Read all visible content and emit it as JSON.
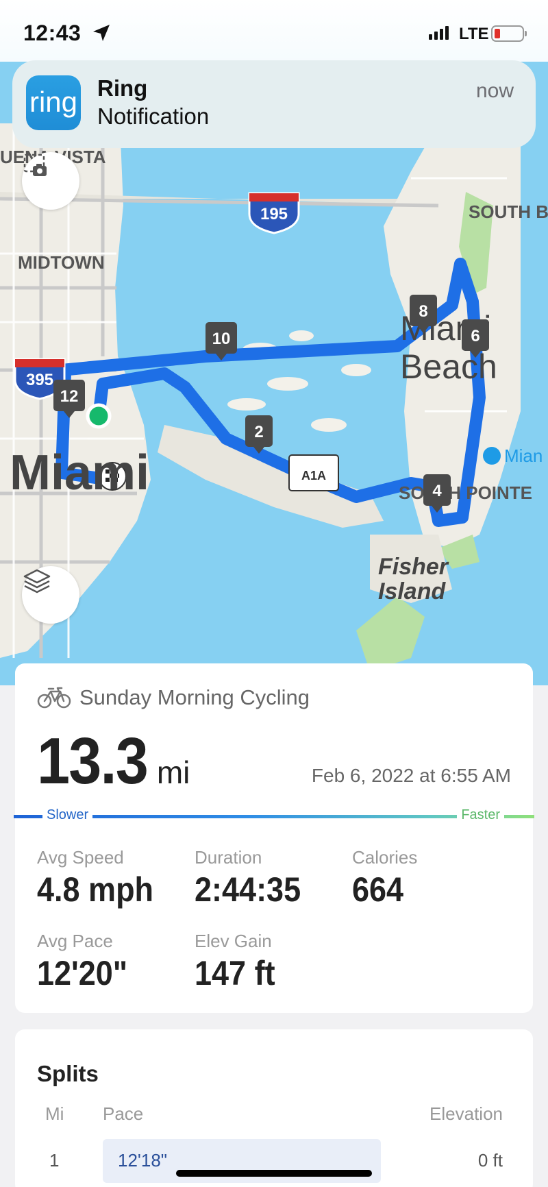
{
  "status_bar": {
    "time": "12:43",
    "network": "LTE"
  },
  "notification": {
    "app_icon_text": "ring",
    "title": "Ring",
    "body": "Notification",
    "time": "now"
  },
  "map": {
    "labels": {
      "buena_vista": "UENA VISTA",
      "south_beach": "SOUTH B",
      "midtown": "MIDTOWN",
      "miami": "Miami",
      "miami_beach_1": "Miami",
      "miami_beach_2": "Beach",
      "south_pointe": "SOUTH POINTE",
      "fisher_1": "Fisher",
      "fisher_2": "Island",
      "miami_poi": "Mian"
    },
    "highway_shields": [
      "195",
      "395",
      "A1A"
    ],
    "mile_markers": [
      "2",
      "4",
      "6",
      "8",
      "10",
      "12"
    ],
    "colors": {
      "water": "#7fcdf0",
      "route": "#1e6fe6",
      "start": "#16b96c"
    },
    "icons": [
      "screenshot-icon",
      "layers-icon",
      "location-arrow-icon",
      "bicycle-icon",
      "finish-flag-icon"
    ]
  },
  "workout": {
    "title": "Sunday Morning Cycling",
    "distance": "13.3",
    "distance_unit": "mi",
    "date": "Feb 6, 2022 at 6:55 AM",
    "speed_legend": {
      "slower": "Slower",
      "faster": "Faster"
    },
    "stats": [
      {
        "label": "Avg Speed",
        "value": "4.8 mph"
      },
      {
        "label": "Duration",
        "value": "2:44:35"
      },
      {
        "label": "Calories",
        "value": "664"
      },
      {
        "label": "Avg Pace",
        "value": "12'20\""
      },
      {
        "label": "Elev Gain",
        "value": "147 ft"
      }
    ]
  },
  "splits": {
    "title": "Splits",
    "columns": {
      "mi": "Mi",
      "pace": "Pace",
      "elevation": "Elevation"
    },
    "rows": [
      {
        "mi": "1",
        "pace": "12'18\"",
        "elevation": "0 ft"
      }
    ]
  }
}
